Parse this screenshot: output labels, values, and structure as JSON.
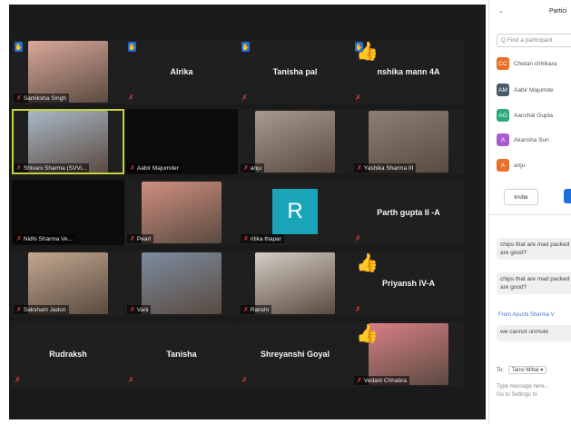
{
  "tiles": [
    {
      "id": "t1",
      "name": "Samiksha Singh",
      "hand": true,
      "photo": "#d9a89a"
    },
    {
      "id": "t2",
      "center": "Alrika",
      "hand": true
    },
    {
      "id": "t3",
      "center": "Tanisha pal",
      "hand": true
    },
    {
      "id": "t4",
      "center": "nshika mann 4A",
      "thumb": true,
      "hand": true
    },
    {
      "id": "t5",
      "name": "Shivani Sharma (SVVi...",
      "photo": "#a9b8c6",
      "speaking": true
    },
    {
      "id": "t6",
      "name": "Aabir Majumder",
      "dark": true
    },
    {
      "id": "t7",
      "name": "anju",
      "photo": "#a89a8f"
    },
    {
      "id": "t8",
      "name": "Yashika Sharma III",
      "photo": "#8c7f75"
    },
    {
      "id": "t9",
      "name": "Nidhi Sharma Ve...",
      "dark": true
    },
    {
      "id": "t10",
      "name": "Pearl",
      "photo": "#cf8f80"
    },
    {
      "id": "t11",
      "name": "ritika thapar",
      "avatar": "R"
    },
    {
      "id": "t12",
      "center": "Parth gupta II -A"
    },
    {
      "id": "t13",
      "name": "Saksham Jadon",
      "photo": "#c2a890"
    },
    {
      "id": "t14",
      "name": "Vani",
      "photo": "#7c8ca0"
    },
    {
      "id": "t15",
      "name": "Ranshi",
      "photo": "#d5cdc4"
    },
    {
      "id": "t16",
      "center": "Priyansh IV-A",
      "thumb": true
    },
    {
      "id": "t17",
      "center": "Rudraksh"
    },
    {
      "id": "t18",
      "center": "Tanisha"
    },
    {
      "id": "t19",
      "center": "Shreyanshi Goyal"
    },
    {
      "id": "t20",
      "name": "Vedant Chhabra",
      "photo": "#d87f86",
      "thumb": true
    }
  ],
  "panel": {
    "chevron": "⌄",
    "title": "Partici",
    "search_placeholder": "Q Find a participant",
    "participants": [
      {
        "initials": "CC",
        "name": "Chetan chhikara",
        "color": "#e8702a"
      },
      {
        "initials": "AM",
        "name": "Aabir Majumde",
        "color": "#4a5a6a"
      },
      {
        "initials": "AG",
        "name": "Aanchal Gupta",
        "color": "#2eaa7a"
      },
      {
        "initials": "A",
        "name": "Akansha Suri",
        "color": "#a85ad0"
      },
      {
        "initials": "A",
        "name": "anju",
        "color": "#e8702a"
      }
    ],
    "invite_label": "Invite",
    "messages": [
      "chips that are mad packed are good?",
      "chips that are mad packed are good?",
      "we cannot unmute"
    ],
    "from_label": "From Ayushi Sharma V",
    "to_label": "To:",
    "to_value": "Tanvi Mittal ▾",
    "type_hint": "Type message here...",
    "settings_hint": "Go to Settings to"
  },
  "icons": {
    "mic_muted": "mic-muted-icon",
    "raise_hand": "raise-hand-icon",
    "thumbs_up": "thumbs-up-icon"
  },
  "colors": {
    "video_bg": "#1a1a1a",
    "tile_bg": "#1f1f1f",
    "active_speaker": "#c8d23a",
    "hand_blue": "#1e6fd9",
    "avatar_teal": "#1aa4b8"
  }
}
